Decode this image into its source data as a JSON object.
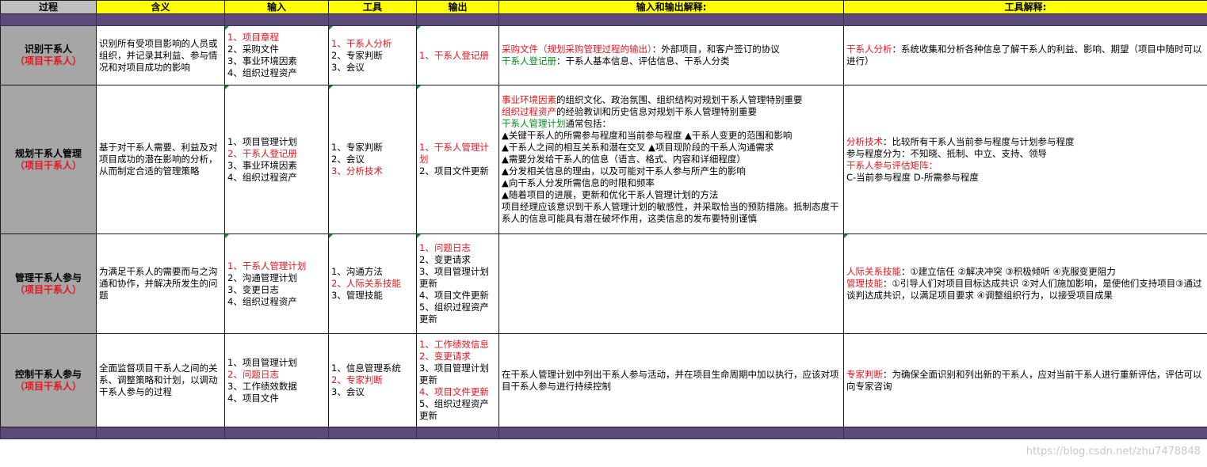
{
  "headers": {
    "process": "过程",
    "meaning": "含义",
    "input": "输入",
    "tools": "工具",
    "output": "输出",
    "io_explain": "输入和输出解释:",
    "tool_explain": "工具解释:"
  },
  "rows": [
    {
      "process": "识别干系人",
      "area": "（项目干系人）",
      "meaning": "识别所有受项目影响的人员或组织，并记录其利益、参与情况和对项目成功的影响",
      "inputs": [
        "1、项目章程",
        "2、采购文件",
        "3、事业环境因素",
        "4、组织过程资产"
      ],
      "tools": [
        "1、干系人分析",
        "2、专家判断",
        "3、会议"
      ],
      "outputs": [
        "1、干系人登记册"
      ],
      "io": [
        [
          "采购文件（规划采购管理过程的输出）",
          "：外部项目，和客户签订的协议"
        ],
        [
          "干系人登记册",
          "：干系人基本信息、评估信息、干系人分类"
        ]
      ],
      "tool_explain": [
        [
          "干系人分析",
          "：系统收集和分析各种信息了解干系人的利益、影响、期望（项目中随时可以进行）"
        ]
      ]
    },
    {
      "process": "规划干系人管理",
      "area": "（项目干系人）",
      "meaning": "基于对干系人需要、利益及对项目成功的潜在影响的分析，从而制定合适的管理策略",
      "inputs": [
        "1、项目管理计划",
        "2、干系人登记册",
        "3、事业环境因素",
        "4、组织过程资产"
      ],
      "tools": [
        "1、专家判断",
        "2、会议",
        "3、分析技术"
      ],
      "outputs": [
        "1、干系人管理计划",
        "2、项目文件更新"
      ],
      "io": {
        "env_red": "事业环境因素",
        "env_rest": "的组织文化、政治氛围、组织结构对规划干系人管理特别重要",
        "opa_red": "组织过程资产",
        "opa_rest": "的经验教训和历史信息对规划干系人管理特别重要",
        "plan_green": "干系人管理计划",
        "plan_rest": "通常包括：",
        "items": [
          "▲关键干系人的所需参与程度和当前参与程度 ▲干系人变更的范围和影响",
          "▲干系人之间的相互关系和潜在交叉  ▲项目现阶段的干系人沟通需求",
          "▲需要分发给干系人的信息（语言、格式、内容和详细程度）",
          "▲分发相关信息的理由，以及可能对干系人参与所产生的影响",
          "▲向干系人分发所需信息的时限和频率",
          "▲随着项目的进展，更新和优化干系人管理计划的方法"
        ],
        "note": "项目经理应该意识到干系人管理计划的敏感性，并采取恰当的预防措施。抵制态度干系人的信息可能具有潜在破坏作用，这类信息的发布要特别谨慎"
      },
      "tool_explain": {
        "l1_red": "分析技术",
        "l1_rest": "：比较所有干系人当前参与程度与计划参与程度",
        "l2": "参与程度分为：不知晓、抵制、中立、支持、领导",
        "l3_red": "干系人参与评估矩阵：",
        "l4": "C-当前参与程度  D-所需参与程度"
      }
    },
    {
      "process": "管理干系人参与",
      "area": "（项目干系人）",
      "meaning": "为满足干系人的需要而与之沟通和协作，并解决所发生的问题",
      "inputs": [
        "1、干系人管理计划",
        "2、沟通管理计划",
        "3、变更日志",
        "4、组织过程资产"
      ],
      "tools": [
        "1、沟通方法",
        "2、人际关系技能",
        "3、管理技能"
      ],
      "outputs": [
        "1、问题日志",
        "2、变更请求",
        "3、项目管理计划更新",
        "4、项目文件更新",
        "5、组织过程资产更新"
      ],
      "tool_explain": [
        [
          "人际关系技能",
          "：①建立信任 ②解决冲突 ③积极倾听 ④克服变更阻力"
        ],
        [
          "管理技能",
          "：①引导人们对项目目标达成共识 ②对人们施加影响，是使他们支持项目③通过谈判达成共识，以满足项目要求 ④调整组织行为，以接受项目成果"
        ]
      ]
    },
    {
      "process": "控制干系人参与",
      "area": "（项目干系人）",
      "meaning": "全面监督项目干系人之间的关系、调整策略和计划，以调动干系人参与的过程",
      "inputs": [
        "1、项目管理计划",
        "2、问题日志",
        "3、工作绩效数据",
        "4、项目文件"
      ],
      "tools": [
        "1、信息管理系统",
        "2、专家判断",
        "3、会议"
      ],
      "outputs": [
        "1、工作绩效信息",
        "2、变更请求",
        "3、项目管理计划更新",
        "4、项目文件更新",
        "5、组织过程资产更新"
      ],
      "io_text": "在干系人管理计划中列出干系人参与活动，并在项目生命周期中加以执行，应该对项目干系人参与进行持续控制",
      "tool_explain": [
        [
          "专家判断",
          "：为确保全面识别和列出新的干系人，应对当前干系人进行重新评估，评估可以向专家咨询"
        ]
      ]
    }
  ],
  "watermark": "https://blog.csdn.net/zhu7478848",
  "colors": {
    "header": "#ffff00",
    "band": "#5c4a7a",
    "process_cell": "#a6a6a6",
    "red": "#e8141c",
    "green": "#0a8a1e"
  }
}
